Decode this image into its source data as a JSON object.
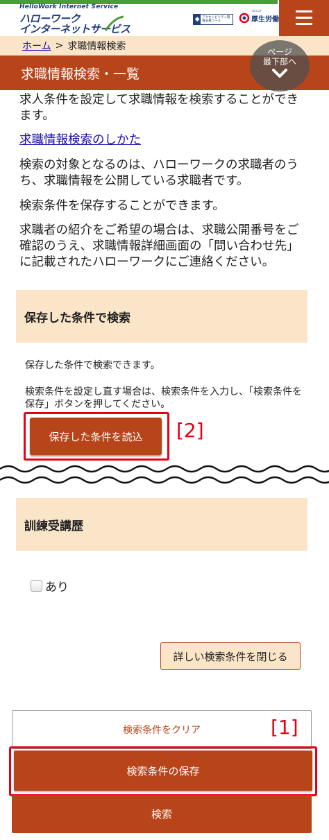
{
  "header": {
    "logo_small": "HelloWork Internet Service",
    "logo_line1": "ハローワーク",
    "logo_line2": "インターネットサービス",
    "accessibility_text": "アクセシビリティ閲覧支援ツール",
    "ministry_sub": "ヨロコビ",
    "ministry_name": "厚生労働省",
    "menu_icon": "hamburger-menu-icon"
  },
  "breadcrumb": {
    "home": "ホーム",
    "separator": ">",
    "current": "求職情報検索"
  },
  "page_title": "求職情報検索・一覧",
  "jump_button": {
    "line1": "ページ",
    "line2": "最下部へ",
    "icon": "chevron-down-icon"
  },
  "intro": {
    "p1": "求人条件を設定して求職情報を検索することができます。",
    "link": "求職情報検索のしかた",
    "p2": "検索の対象となるのは、ハローワークの求職者のうち、求職情報を公開している求職者です。",
    "p3": "検索条件を保存することができます。",
    "p4": "求職者の紹介をご希望の場合は、求職公開番号をご確認のうえ、求職情報詳細画面の「問い合わせ先」に記載されたハローワークにご連絡ください。"
  },
  "saved_section": {
    "title": "保存した条件で検索",
    "text1": "保存した条件で検索できます。",
    "text2": "検索条件を設定し直す場合は、検索条件を入力し、「検索条件を保存」ボタンを押してください。",
    "load_button": "保存した条件を読込",
    "annotation": "[2]"
  },
  "training_section": {
    "title": "訓練受講歴",
    "checkbox_label": "あり"
  },
  "buttons": {
    "close_detail": "詳しい検索条件を閉じる",
    "clear": "検索条件をクリア",
    "save": "検索条件の保存",
    "search": "検索",
    "annotation": "[1]"
  },
  "colors": {
    "accent": "#b8451a",
    "pale": "#fbe5c8",
    "highlight": "#e60012",
    "link": "#1a0dab"
  }
}
